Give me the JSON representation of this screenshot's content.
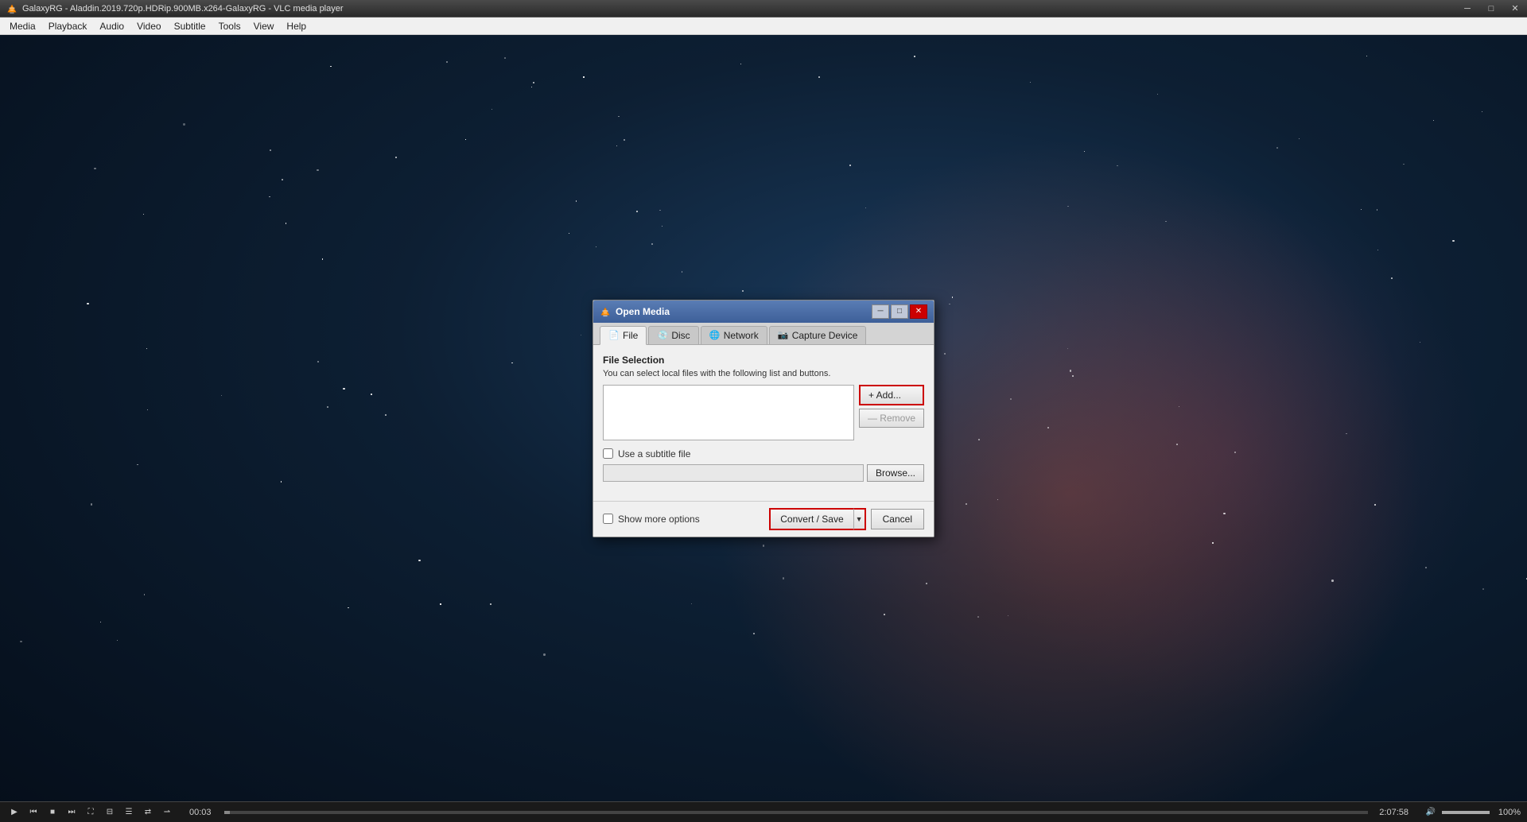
{
  "window": {
    "title": "GalaxyRG - Aladdin.2019.720p.HDRip.900MB.x264-GalaxyRG - VLC media player"
  },
  "titlebar": {
    "minimize_label": "─",
    "restore_label": "□",
    "close_label": "✕"
  },
  "menubar": {
    "items": [
      "Media",
      "Playback",
      "Audio",
      "Video",
      "Subtitle",
      "Tools",
      "View",
      "Help"
    ]
  },
  "statusbar": {
    "time_left": "00:03",
    "time_right": "2:07:58",
    "volume_pct": "100%"
  },
  "dialog": {
    "title": "Open Media",
    "minimize_label": "─",
    "restore_label": "□",
    "close_label": "✕",
    "tabs": [
      {
        "id": "file",
        "label": "File",
        "active": true
      },
      {
        "id": "disc",
        "label": "Disc",
        "active": false
      },
      {
        "id": "network",
        "label": "Network",
        "active": false
      },
      {
        "id": "capture",
        "label": "Capture Device",
        "active": false
      }
    ],
    "file_section": {
      "title": "File Selection",
      "description": "You can select local files with the following list and buttons.",
      "add_button": "+ Add...",
      "remove_button": "— Remove"
    },
    "subtitle": {
      "checkbox_label": "Use a subtitle file",
      "browse_button": "Browse..."
    },
    "footer": {
      "show_more_label": "Show more options",
      "convert_save_label": "Convert / Save",
      "cancel_label": "Cancel"
    }
  }
}
